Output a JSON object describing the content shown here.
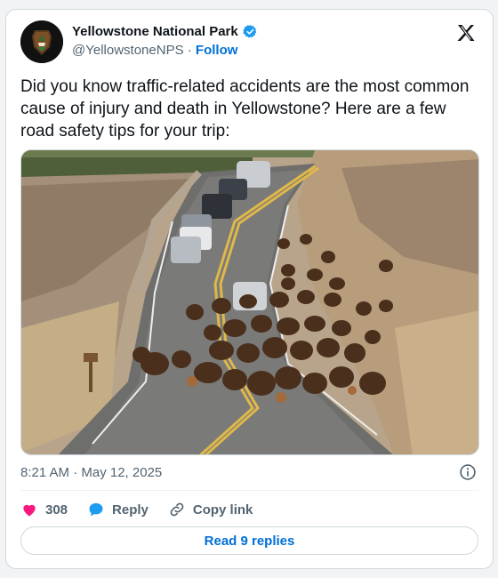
{
  "author": {
    "display_name": "Yellowstone National Park",
    "handle": "@YellowstoneNPS",
    "separator": "·",
    "follow_label": "Follow",
    "verified_color": "#1d9bf0"
  },
  "tweet": {
    "text": "Did you know traffic-related accidents are the most common cause of injury and death in Yellowstone? Here are a few road safety tips for your trip:",
    "time": "8:21 AM · May 12, 2025"
  },
  "actions": {
    "likes_count": "308",
    "reply_label": "Reply",
    "copy_link_label": "Copy link",
    "like_color": "#f91880",
    "reply_color": "#1d9bf0"
  },
  "replies_button": {
    "label": "Read 9 replies"
  },
  "colors": {
    "link": "#006fd6",
    "muted": "#536471",
    "border": "#cfd9de"
  }
}
